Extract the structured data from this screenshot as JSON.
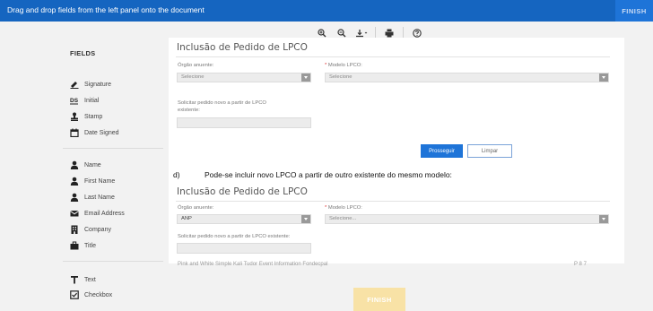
{
  "topbar": {
    "title": "Drag and drop fields from the left panel onto the document",
    "finish_label": "FINISH"
  },
  "toolbar": {
    "icons": [
      "zoom-in-icon",
      "zoom-out-icon",
      "download-icon",
      "print-icon",
      "help-icon"
    ]
  },
  "sidebar": {
    "title": "FIELDS",
    "group1": [
      "Signature",
      "Initial",
      "Stamp",
      "Date Signed"
    ],
    "group2": [
      "Name",
      "First Name",
      "Last Name",
      "Email Address",
      "Company",
      "Title"
    ],
    "group3": [
      "Text",
      "Checkbox"
    ]
  },
  "doc": {
    "section1": {
      "title": "Inclusão de Pedido de LPCO",
      "orgao_label": "Órgão anuente:",
      "orgao_value": "Selecione",
      "modelo_label": "Modelo LPCO:",
      "modelo_value": "Selecione",
      "solicitar_label_1": "Solicitar pedido novo a partir de LPCO",
      "solicitar_label_2": "existente:",
      "prosseguir": "Prosseguir",
      "limpar": "Limpar"
    },
    "step_d": {
      "marker": "d)",
      "text": "Pode-se incluir novo LPCO a partir de outro existente do mesmo modelo:"
    },
    "section2": {
      "title": "Inclusão de Pedido de LPCO",
      "orgao_label": "Órgão anuente:",
      "orgao_value": "ANP",
      "modelo_label": "Modelo LPCO:",
      "modelo_value": "Selecione...",
      "solicitar_label": "Solicitar pedido novo a partir de LPCO existente:"
    },
    "background_text": "Pink and White Simple Kali Tudor Event Information Fondecpal",
    "page_marker": "P 8 7"
  },
  "bottom": {
    "finish_label": "FINISH"
  }
}
